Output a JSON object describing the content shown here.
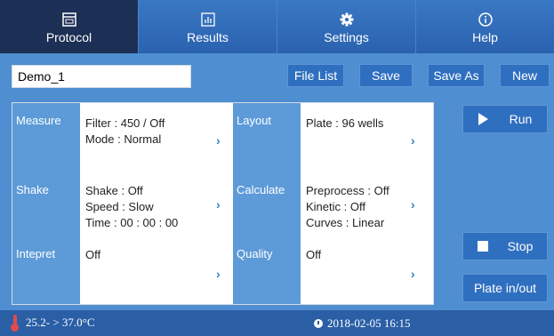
{
  "nav": {
    "tabs": [
      {
        "label": "Protocol",
        "icon": "screen-icon",
        "active": true
      },
      {
        "label": "Results",
        "icon": "bar-chart-icon",
        "active": false
      },
      {
        "label": "Settings",
        "icon": "gear-icon",
        "active": false
      },
      {
        "label": "Help",
        "icon": "info-icon",
        "active": false
      }
    ]
  },
  "toolbar": {
    "protocol_name": "Demo_1",
    "file_list_label": "File List",
    "save_label": "Save",
    "save_as_label": "Save As",
    "new_label": "New"
  },
  "panel": {
    "measure": {
      "label": "Measure",
      "filter": "Filter : 450 / Off",
      "mode": "Mode : Normal"
    },
    "layout": {
      "label": "Layout",
      "plate": "Plate :  96 wells"
    },
    "shake": {
      "label": "Shake",
      "shake": "Shake : Off",
      "speed": "Speed : Slow",
      "time": "Time :  00 : 00 : 00"
    },
    "calculate": {
      "label": "Calculate",
      "preprocess": "Preprocess : Off",
      "kinetic": "Kinetic : Off",
      "curves": "Curves : Linear"
    },
    "intepret": {
      "label": "Intepret",
      "value": "Off"
    },
    "quality": {
      "label": "Quality",
      "value": "Off"
    },
    "chevron": "›"
  },
  "side": {
    "run_label": "Run",
    "stop_label": "Stop",
    "plate_label": "Plate in/out"
  },
  "status": {
    "temperature": "25.2- > 37.0°C",
    "datetime": "2018-02-05 16:15"
  },
  "colors": {
    "background": "#4f8ed0",
    "nav_active": "#1c2f55",
    "button": "#2f6fc0",
    "label_cell": "#5d9ad8",
    "status_bar": "#2a5fa6",
    "thermometer": "#e34a4a"
  }
}
